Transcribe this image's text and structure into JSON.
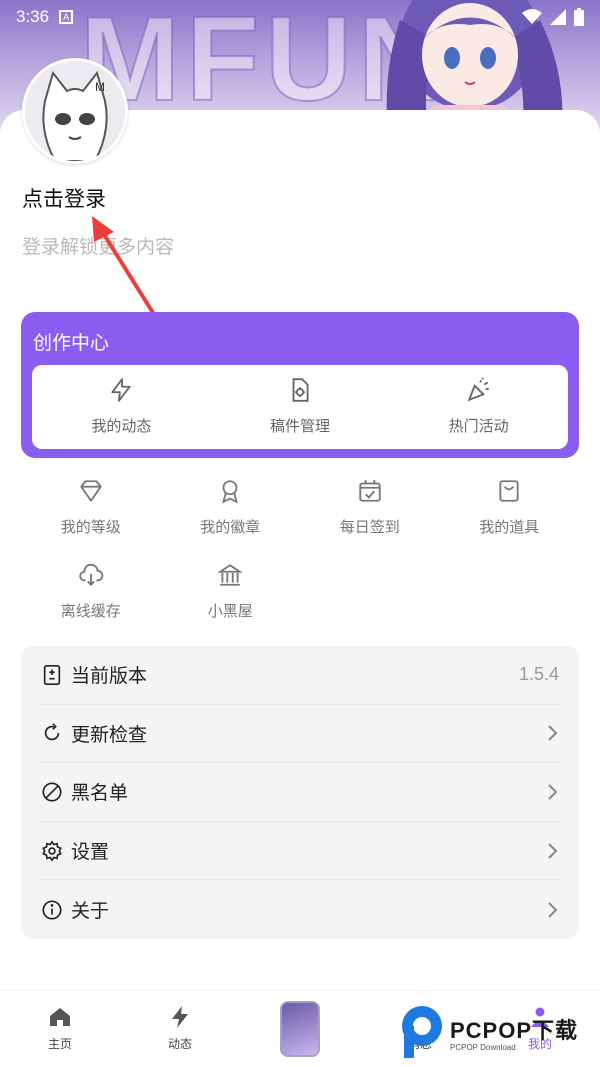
{
  "status_bar": {
    "time": "3:36",
    "notification_letter": "A"
  },
  "banner": {
    "text": "MFUN"
  },
  "profile": {
    "login_title": "点击登录",
    "login_subtitle": "登录解锁更多内容"
  },
  "creation_center": {
    "title": "创作中心",
    "items": [
      {
        "label": "我的动态",
        "icon": "lightning-icon"
      },
      {
        "label": "稿件管理",
        "icon": "file-settings-icon"
      },
      {
        "label": "热门活动",
        "icon": "party-popper-icon"
      }
    ]
  },
  "grid": {
    "items": [
      {
        "label": "我的等级",
        "icon": "diamond-icon"
      },
      {
        "label": "我的徽章",
        "icon": "medal-icon"
      },
      {
        "label": "每日签到",
        "icon": "calendar-check-icon"
      },
      {
        "label": "我的道具",
        "icon": "shopping-bag-icon"
      },
      {
        "label": "离线缓存",
        "icon": "cloud-download-icon"
      },
      {
        "label": "小黑屋",
        "icon": "building-icon"
      }
    ]
  },
  "settings": {
    "items": [
      {
        "label": "当前版本",
        "value": "1.5.4",
        "icon": "version-icon"
      },
      {
        "label": "更新检查",
        "icon": "refresh-icon"
      },
      {
        "label": "黑名单",
        "icon": "block-icon"
      },
      {
        "label": "设置",
        "icon": "gear-icon"
      },
      {
        "label": "关于",
        "icon": "info-icon"
      }
    ]
  },
  "bottom_nav": {
    "items": [
      {
        "label": "主页",
        "icon": "home-icon"
      },
      {
        "label": "动态",
        "icon": "lightning-icon"
      },
      {
        "label": "",
        "icon": "center-avatar-icon"
      },
      {
        "label": "消息",
        "icon": "message-icon"
      },
      {
        "label": "我的",
        "icon": "person-icon"
      }
    ],
    "active": "我的"
  },
  "watermark": {
    "main": "PCPOP下载",
    "sub": "PCPOP Download"
  },
  "colors": {
    "accent": "#8a5cf0",
    "list_bg": "#f4f4f4",
    "banner": "#8a74c9"
  }
}
